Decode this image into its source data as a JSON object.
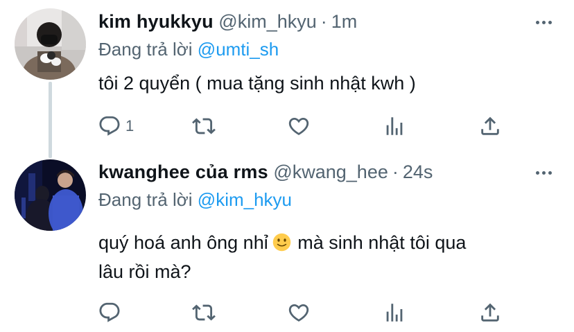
{
  "tweets": [
    {
      "name": "kim hyukkyu",
      "handle": "@kim_hkyu",
      "separator": "·",
      "time": "1m",
      "reply_prefix": "Đang trả lời",
      "reply_to": "@umti_sh",
      "text_lines": [
        "tôi 2 quyển ( mua tặng sinh nhật kwh )"
      ],
      "reply_count": "1"
    },
    {
      "name": "kwanghee của rms",
      "handle": "@kwang_hee",
      "separator": "·",
      "time": "24s",
      "reply_prefix": "Đang trả lời",
      "reply_to": "@kim_hkyu",
      "text_line1_before": "quý hoá anh ông nhỉ",
      "text_line1_after": " mà sinh nhật tôi qua",
      "text_line2": "lâu rồi mà?",
      "reply_count": ""
    }
  ],
  "colors": {
    "text": "#0f1419",
    "secondary": "#536471",
    "link": "#1d9bf0",
    "thread_line": "#cfd9de"
  },
  "icons": [
    "reply-icon",
    "retweet-icon",
    "like-icon",
    "stats-icon",
    "share-icon",
    "more-icon",
    "slightly-smiling-face-emoji"
  ]
}
